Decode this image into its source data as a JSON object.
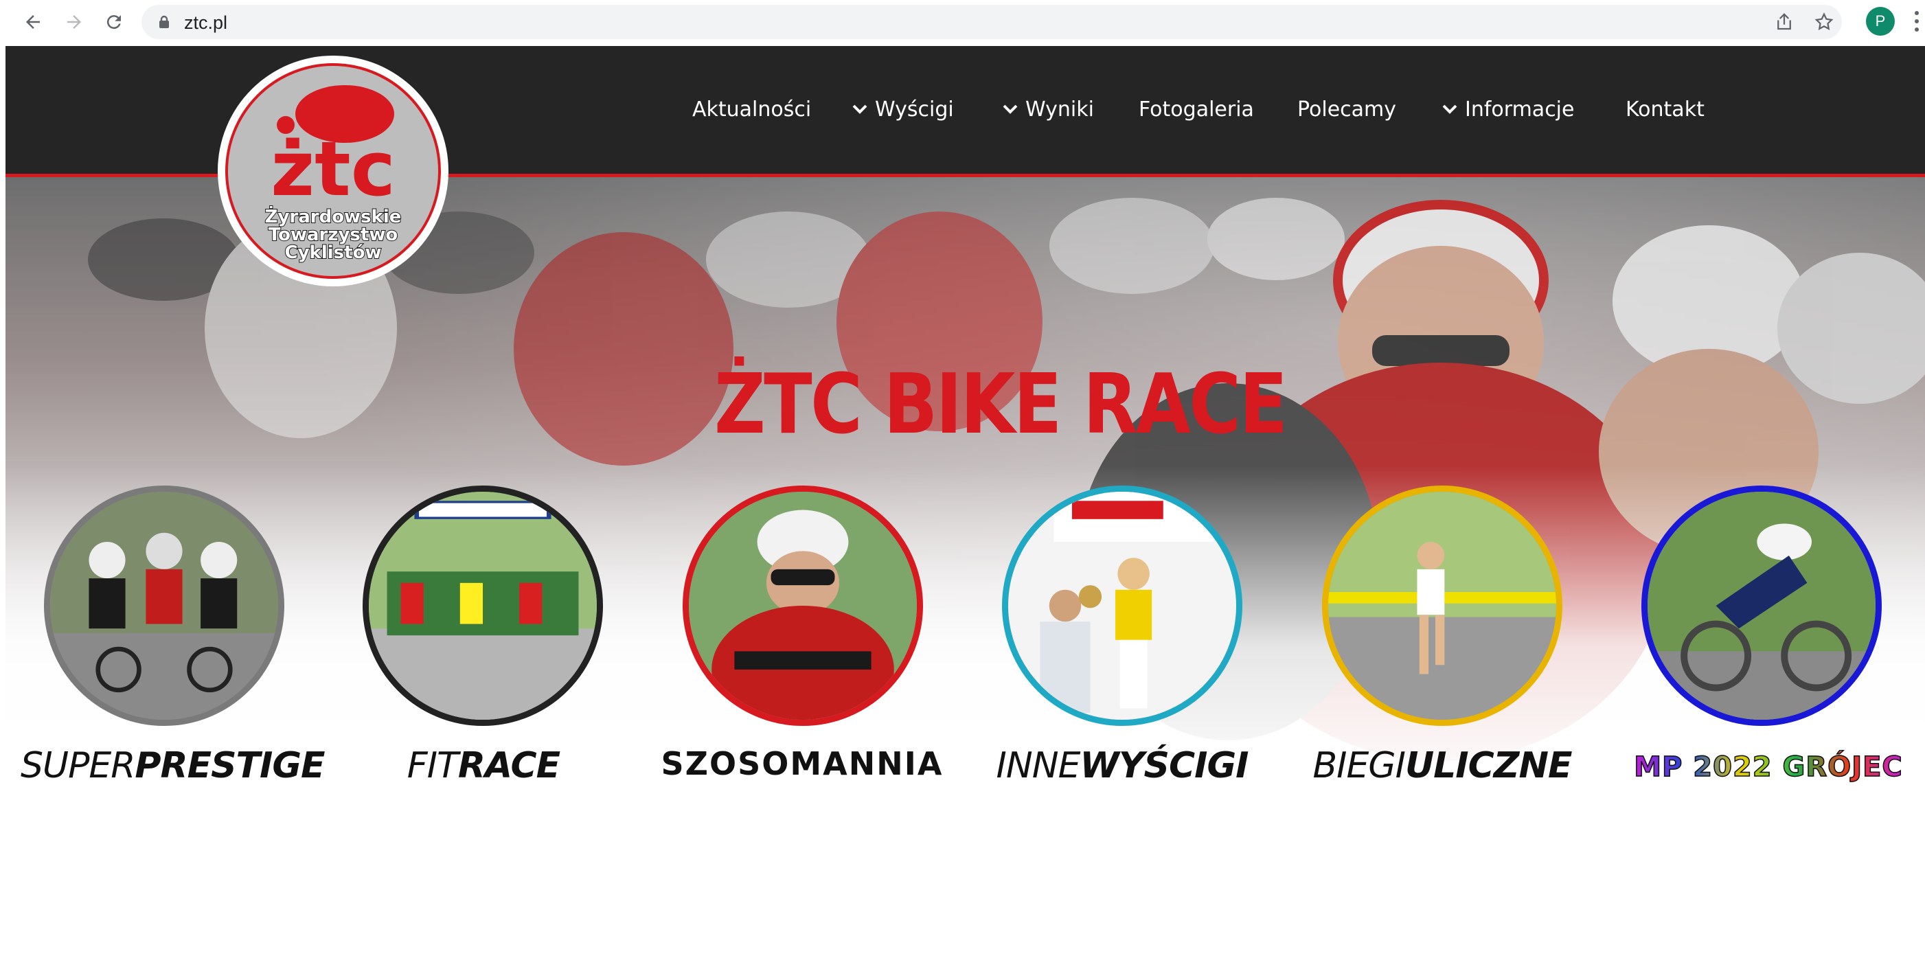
{
  "browser": {
    "url": "ztc.pl",
    "profile_initial": "P"
  },
  "site": {
    "logo": {
      "mark": "żtc",
      "lines": [
        "Żyrardowskie",
        "Towarzystwo",
        "Cyklistów"
      ]
    },
    "menu": [
      {
        "label": "Aktualności",
        "dropdown": false
      },
      {
        "label": "Wyścigi",
        "dropdown": true
      },
      {
        "label": "Wyniki",
        "dropdown": true
      },
      {
        "label": "Fotogaleria",
        "dropdown": false
      },
      {
        "label": "Polecamy",
        "dropdown": false
      },
      {
        "label": "Informacje",
        "dropdown": true
      },
      {
        "label": "Kontakt",
        "dropdown": false
      }
    ],
    "hero": {
      "headline": "ŻTC BIKE RACE"
    },
    "events": [
      {
        "name_light": "SUPER",
        "name_bold": "PRESTIGE",
        "ring_color": "#7a7a7a"
      },
      {
        "name_light": "FIT",
        "name_bold": "RACE",
        "ring_color": "#222222"
      },
      {
        "name_light": "",
        "name_bold": "SZOSOMANNIA",
        "ring_color": "#d71920"
      },
      {
        "name_light": "INNE",
        "name_bold": "WYŚCIGI",
        "ring_color": "#1fa9c4"
      },
      {
        "name_light": "BIEGI",
        "name_bold": "ULICZNE",
        "ring_color": "#e8b400"
      },
      {
        "name_light": "",
        "name_bold": "MP 2022 GRÓJEC",
        "ring_color": "#1818d6"
      }
    ]
  },
  "colors": {
    "brand_red": "#d71920",
    "header_bg": "#252525"
  },
  "icons": [
    "back-arrow-icon",
    "forward-arrow-icon",
    "reload-icon",
    "lock-icon",
    "share-icon",
    "star-icon",
    "kebab-menu-icon",
    "chevron-down-icon"
  ]
}
